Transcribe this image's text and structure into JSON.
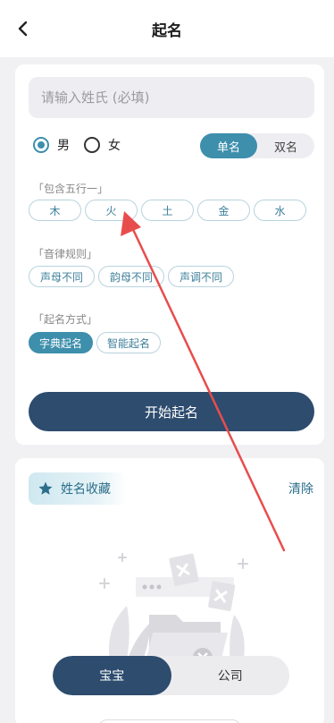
{
  "header": {
    "title": "起名"
  },
  "form": {
    "surname_placeholder": "请输入姓氏 (必填)",
    "gender": {
      "male": "男",
      "female": "女",
      "selected": "男"
    },
    "name_type": {
      "single": "单名",
      "double": "双名",
      "selected": "单名"
    },
    "elements": {
      "label": "「包含五行一」",
      "options": [
        "木",
        "火",
        "土",
        "金",
        "水"
      ]
    },
    "rules": {
      "label": "「音律规则」",
      "options": [
        "声母不同",
        "韵母不同",
        "声调不同"
      ]
    },
    "method": {
      "label": "「起名方式」",
      "options": [
        "字典起名",
        "智能起名"
      ],
      "selected": "字典起名"
    },
    "start_label": "开始起名"
  },
  "favorites": {
    "title": "姓名收藏",
    "clear_label": "清除"
  },
  "bottom_tabs": {
    "baby": "宝宝",
    "company": "公司",
    "selected": "宝宝"
  },
  "colors": {
    "accent": "#3d8fac",
    "primary_button": "#2d4c6e",
    "annotation_arrow": "#e84d4d"
  }
}
